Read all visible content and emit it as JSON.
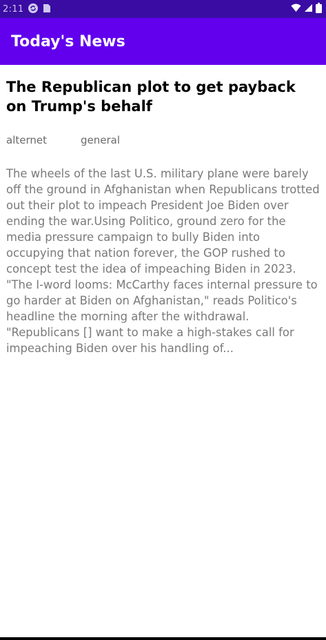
{
  "status_bar": {
    "time": "2:11",
    "icons": [
      "sync-icon",
      "sim-card-icon",
      "wifi-icon",
      "signal-icon",
      "battery-icon"
    ]
  },
  "app_bar": {
    "title": "Today's News"
  },
  "article": {
    "title": "The Republican plot to get payback on Trump's behalf",
    "source": "alternet",
    "category": "general",
    "body": "The wheels of the last U.S. military plane were barely off the ground in Afghanistan when Republicans trotted out their plot to impeach President Joe Biden over ending the war.Using Politico, ground zero for the media pressure campaign to bully Biden into occupying that nation forever, the GOP rushed to concept test the idea of impeaching Biden in 2023. \"The I-word looms: McCarthy faces internal pressure to go harder at Biden on Afghanistan,\" reads Politico's headline the morning after the withdrawal. \"Republicans [] want to make a high-stakes call for impeaching Biden over his handling of..."
  },
  "colors": {
    "status_bar": "#3a0ca3",
    "app_bar": "#6200ee",
    "title_text": "#000000",
    "meta_text": "#6b6b6b",
    "body_text": "#7a7a7a"
  }
}
